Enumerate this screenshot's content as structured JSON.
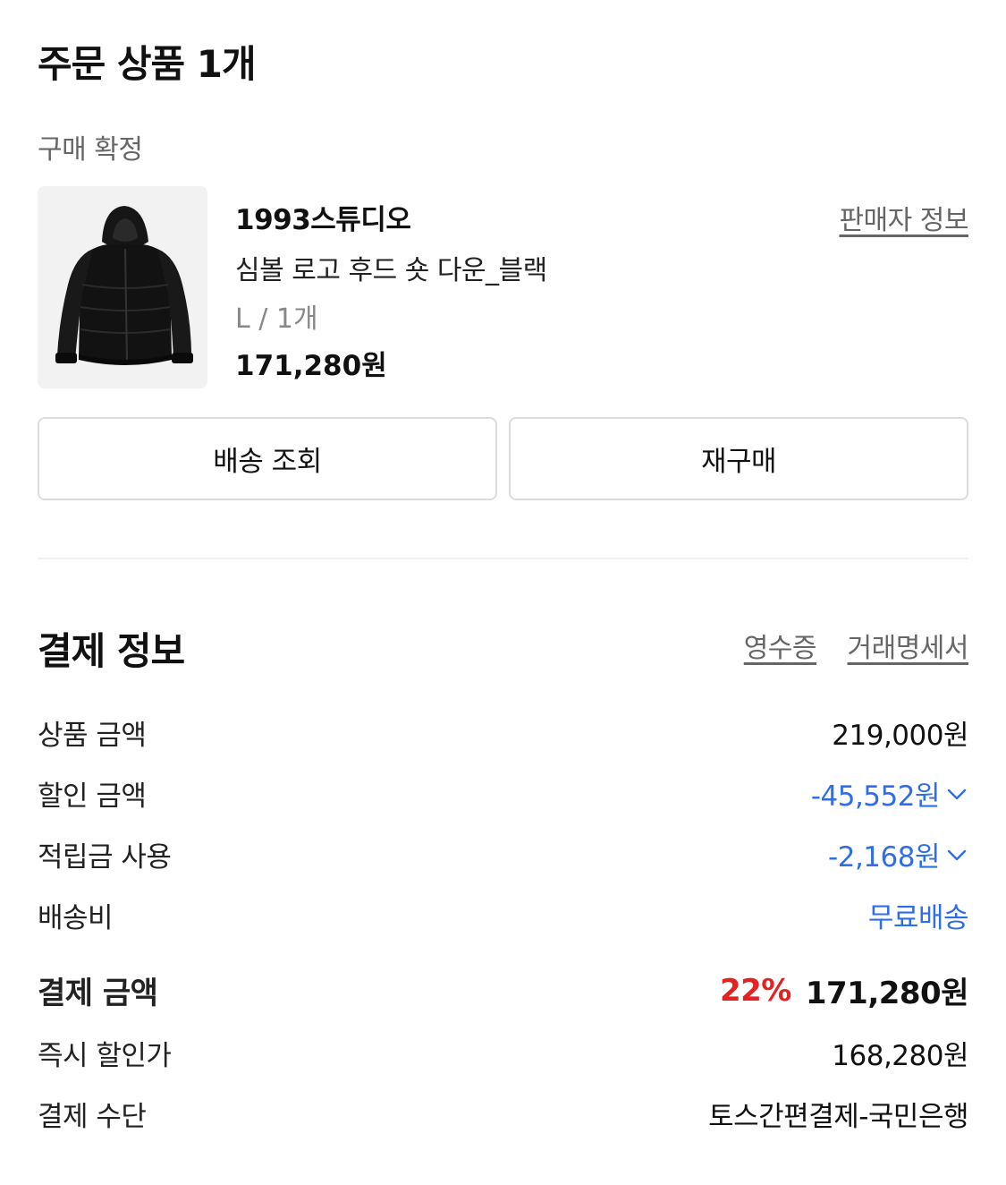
{
  "order": {
    "title": "주문 상품 1개",
    "status": "구매 확정",
    "item": {
      "brand": "1993스튜디오",
      "name": "심볼 로고 후드 숏 다운_블랙",
      "option": "L / 1개",
      "price": "171,280원",
      "image_icon": "black-puffer-jacket-image"
    },
    "seller_link": "판매자 정보",
    "buttons": {
      "track": "배송 조회",
      "rebuy": "재구매"
    }
  },
  "payment": {
    "title": "결제 정보",
    "receipt_link": "영수증",
    "statement_link": "거래명세서",
    "rows": [
      {
        "label": "상품 금액",
        "value": "219,000원"
      },
      {
        "label": "할인 금액",
        "value": "-45,552원"
      },
      {
        "label": "적립금 사용",
        "value": "-2,168원"
      },
      {
        "label": "배송비",
        "value": "무료배송"
      }
    ],
    "total": {
      "label": "결제 금액",
      "percent": "22%",
      "value": "171,280원"
    },
    "instant": {
      "label": "즉시 할인가",
      "value": "168,280원"
    },
    "method": {
      "label": "결제 수단",
      "value": "토스간편결제-국민은행"
    }
  },
  "colors": {
    "accent_blue": "#2f6ee6",
    "discount_red": "#e52222",
    "muted_text": "#666666",
    "border": "#dcdcdc"
  }
}
